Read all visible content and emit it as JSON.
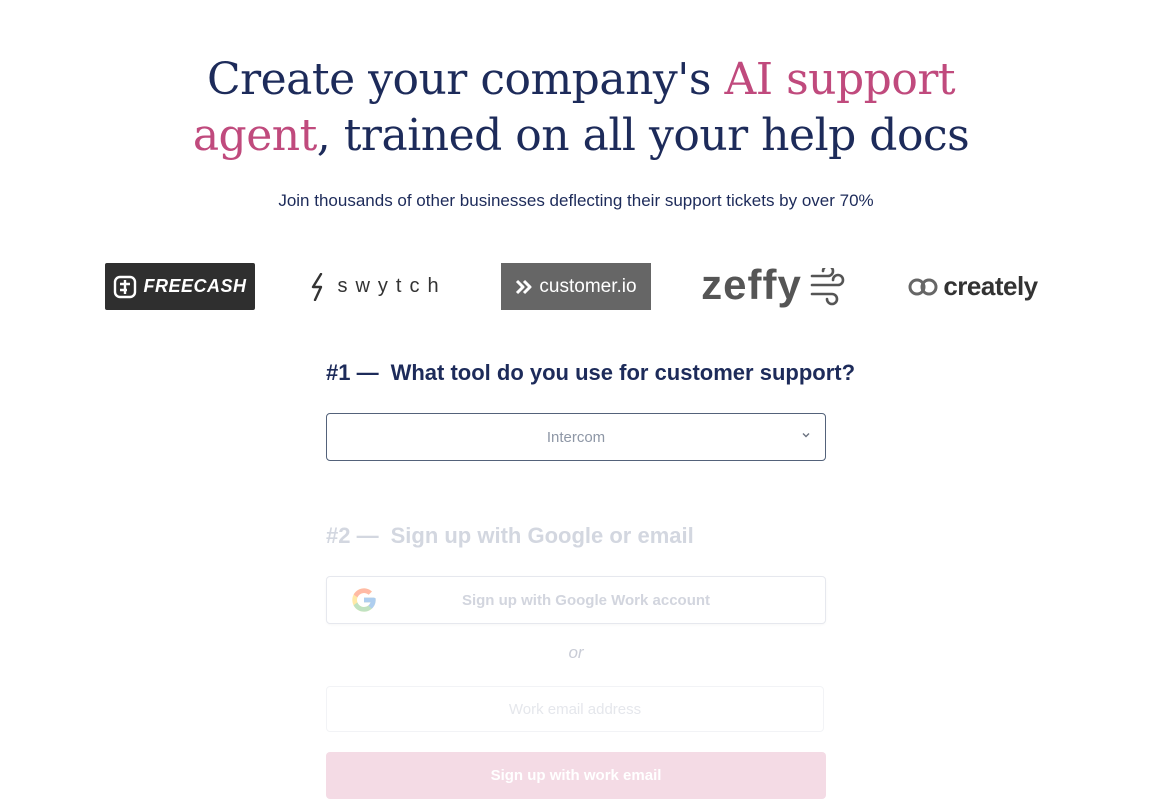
{
  "hero": {
    "title_line1_plain": "Create your company's ",
    "title_line1_accent": "AI support",
    "title_line2_accent": "agent",
    "title_line2_plain": ", trained on all your help docs",
    "subtitle": "Join thousands of other businesses deflecting their support tickets by over 70%"
  },
  "logos": [
    {
      "name": "FREECASH",
      "icon": "freecash-mark-icon"
    },
    {
      "name": "swytch",
      "icon": "swytch-bolt-icon"
    },
    {
      "name": "customer.io",
      "icon": "customerio-mark-icon"
    },
    {
      "name": "zeffy",
      "icon": "zeffy-wind-icon"
    },
    {
      "name": "creately",
      "icon": "creately-infinity-icon"
    }
  ],
  "step1": {
    "number": "#1 —",
    "title": "What tool do you use for customer support?",
    "select_value": "Intercom"
  },
  "step2": {
    "number": "#2 —",
    "title": "Sign up with Google or email",
    "google_button": "Sign up with Google Work account",
    "or_text": "or",
    "email_placeholder": "Work email address",
    "email_button": "Sign up with work email"
  },
  "colors": {
    "navy": "#1d2b5a",
    "accent": "#c04a7d",
    "disabled_button": "#f4dbe5"
  }
}
